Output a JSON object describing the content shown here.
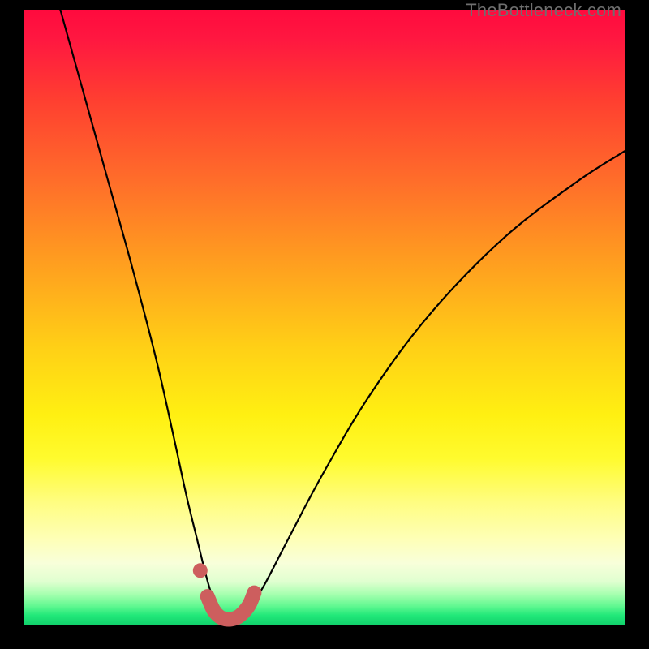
{
  "watermark": "TheBottleneck.com",
  "chart_data": {
    "type": "line",
    "title": "",
    "xlabel": "",
    "ylabel": "",
    "xlim": [
      0,
      100
    ],
    "ylim": [
      0,
      100
    ],
    "grid": false,
    "legend": false,
    "description": "Bottleneck curve: a V-shaped curve indicating performance mismatch percentage vs hardware balance axis. Minimum (~0% bottleneck, green zone) near x≈34; both tails rise toward 100% (red zone). Left branch steeper than right branch.",
    "series": [
      {
        "name": "bottleneck-curve",
        "x": [
          6,
          10,
          14,
          18,
          22,
          25,
          27,
          29,
          30,
          31,
          32,
          33,
          34,
          35,
          36,
          37,
          38,
          40,
          44,
          50,
          58,
          68,
          80,
          92,
          100
        ],
        "y": [
          100,
          86,
          72,
          58,
          43,
          30,
          21,
          13,
          9,
          5.5,
          3,
          1.5,
          0.8,
          0.8,
          1.2,
          2,
          3.5,
          6.5,
          14,
          25,
          38,
          51,
          63,
          72,
          77
        ]
      }
    ],
    "highlight": {
      "description": "Thick salmon overlay near the curve minimum with an isolated dot just left of it.",
      "dot": {
        "x": 29.3,
        "y": 8.8
      },
      "segment_x": [
        30.5,
        31.5,
        32.5,
        33.5,
        34.5,
        35.5,
        36.5,
        37.5,
        38.3
      ],
      "segment_y": [
        4.6,
        2.4,
        1.3,
        0.9,
        0.9,
        1.2,
        2.0,
        3.3,
        5.2
      ]
    },
    "colors": {
      "curve": "#000000",
      "highlight": "#cd5e5e",
      "gradient_top": "#ff0a3e",
      "gradient_bottom": "#12d26c"
    }
  }
}
